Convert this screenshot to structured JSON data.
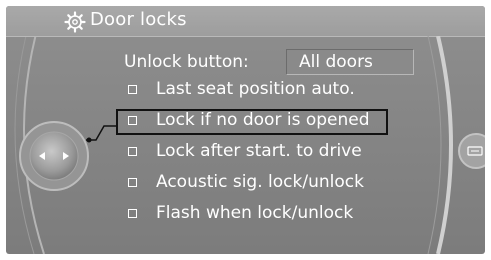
{
  "header": {
    "title": "Door locks",
    "icon": "gear-car-settings-icon"
  },
  "settings": {
    "unlock_label": "Unlock button:",
    "unlock_value": "All doors"
  },
  "options": [
    {
      "label": "Last seat position auto.",
      "checked": false,
      "selected": false
    },
    {
      "label": "Lock if no door is opened",
      "checked": false,
      "selected": true
    },
    {
      "label": "Lock after start. to drive",
      "checked": false,
      "selected": false
    },
    {
      "label": "Acoustic sig. lock/unlock",
      "checked": false,
      "selected": false
    },
    {
      "label": "Flash when lock/unlock",
      "checked": false,
      "selected": false
    }
  ],
  "colors": {
    "panel": "#888888",
    "title_bar": "#a3a3a3",
    "text": "#ffffff",
    "selection_frame": "#111111"
  }
}
